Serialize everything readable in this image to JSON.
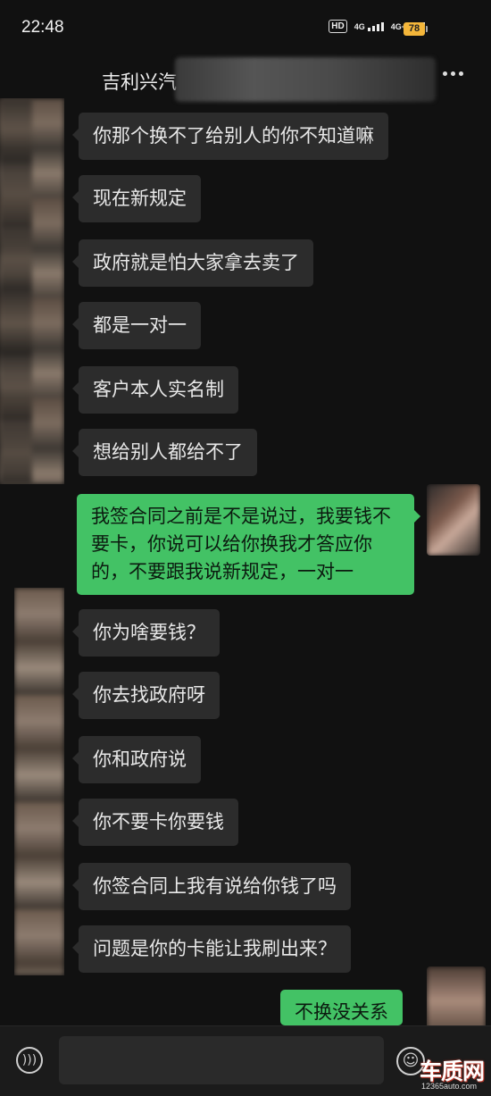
{
  "status_bar": {
    "time": "22:48",
    "hd_label": "HD",
    "sim1_label": "4G",
    "sim2_label": "4G+",
    "battery": "78"
  },
  "header": {
    "title": "吉利兴汽",
    "more_icon": "more-dots-icon"
  },
  "messages": [
    {
      "side": "in",
      "text": "你那个换不了给别人的你不知道嘛"
    },
    {
      "side": "in",
      "text": "现在新规定"
    },
    {
      "side": "in",
      "text": "政府就是怕大家拿去卖了"
    },
    {
      "side": "in",
      "text": "都是一对一"
    },
    {
      "side": "in",
      "text": "客户本人实名制"
    },
    {
      "side": "in",
      "text": "想给别人都给不了"
    },
    {
      "side": "out",
      "text": "我签合同之前是不是说过，我要钱不要卡，你说可以给你换我才答应你的，不要跟我说新规定，一对一"
    },
    {
      "side": "in",
      "text": "你为啥要钱？"
    },
    {
      "side": "in",
      "text": "你去找政府呀"
    },
    {
      "side": "in",
      "text": "你和政府说"
    },
    {
      "side": "in",
      "text": "你不要卡你要钱"
    },
    {
      "side": "in",
      "text": "你签合同上我有说给你钱了吗"
    },
    {
      "side": "in",
      "text": "问题是你的卡能让我刷出来？"
    },
    {
      "side": "out",
      "text": "不换没关系"
    }
  ],
  "input_bar": {
    "voice_icon": "voice-icon",
    "emoji_icon": "emoji-icon"
  },
  "watermark": {
    "main": "车质网",
    "sub": "12365auto.com"
  },
  "colors": {
    "background": "#111111",
    "incoming_bubble": "#2c2c2c",
    "outgoing_bubble": "#43c265",
    "battery": "#f4b63a"
  }
}
